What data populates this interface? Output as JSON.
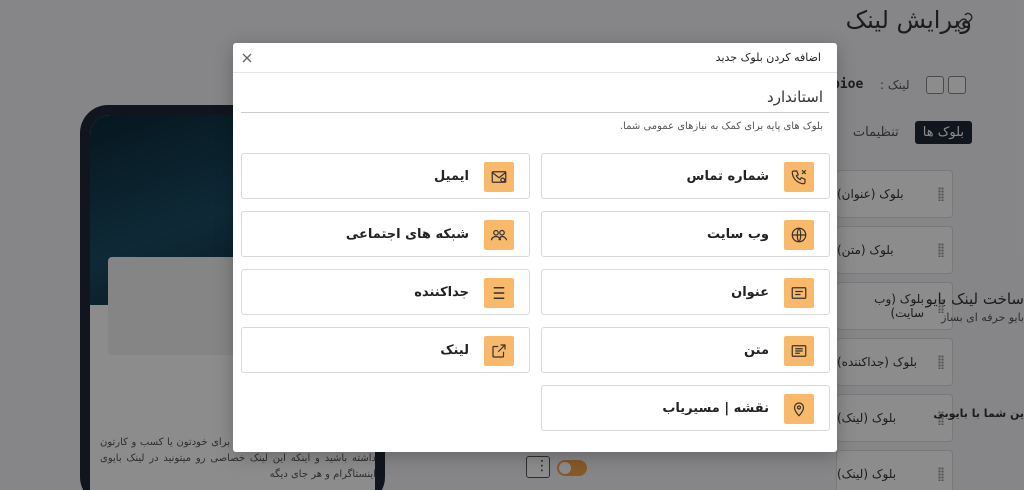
{
  "page": {
    "title": "ویرایش لینک",
    "username": "bioe",
    "link_label": "لینک :",
    "tabs": [
      {
        "label": "بلوک ها",
        "active": true
      },
      {
        "label": "تنظیمات",
        "active": false
      }
    ],
    "blocks": [
      "بلوک (عنوان)",
      "بلوک (متن)",
      "بلوک (وب سایت)",
      "بلوک (جداکننده)",
      "بلوک (لینک)",
      "بلوک (لینک)"
    ]
  },
  "preview": {
    "card_title": "ساخت لینک بایو",
    "card_subtitle": "بایو حرفه ای بساز",
    "greeting": "ین شما با بایوبی",
    "text": "خصاصی بسازید و بایوبی حرفه ای برای خودتون یا کسب و کارتون داشته باشید و اینکه این لینک خصاصی رو میتونید در لینک بایوی اینستاگرام و هر جای دیگه"
  },
  "modal": {
    "title": "اضافه کردن بلوک جدید",
    "section_title": "استاندارد",
    "section_description": "بلوک های پایه برای کمک به نیازهای عمومی شما.",
    "items": [
      {
        "label": "شماره تماس",
        "icon": "phone-icon"
      },
      {
        "label": "ایمیل",
        "icon": "email-icon"
      },
      {
        "label": "وب سایت",
        "icon": "globe-icon"
      },
      {
        "label": "شبکه های اجتماعی",
        "icon": "users-icon"
      },
      {
        "label": "عنوان",
        "icon": "title-icon"
      },
      {
        "label": "جداکننده",
        "icon": "divider-icon"
      },
      {
        "label": "متن",
        "icon": "text-icon"
      },
      {
        "label": "لینک",
        "icon": "external-link-icon"
      },
      {
        "label": "نقشه | مسیریاب",
        "icon": "map-pin-icon"
      }
    ]
  },
  "colors": {
    "accent": "#f9b96b",
    "tab_active": "#1f2937",
    "toggle": "#f4a34a"
  }
}
